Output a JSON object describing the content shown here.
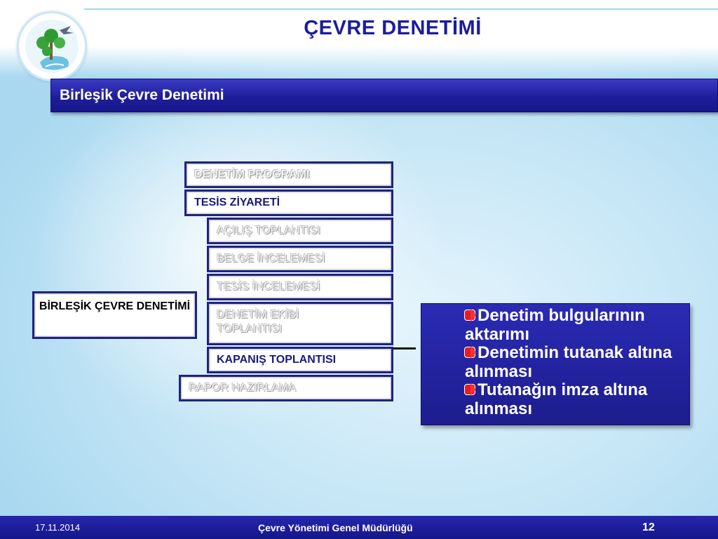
{
  "slide": {
    "title": "ÇEVRE DENETİMİ",
    "section": "Birleşik Çevre Denetimi"
  },
  "diagram": {
    "root": "BİRLEŞİK ÇEVRE DENETİMİ",
    "steps": [
      {
        "label": "DENETİM PROGRAMI",
        "state": "faded"
      },
      {
        "label": "TESİS ZİYARETİ",
        "state": "active"
      },
      {
        "label": "AÇILIŞ TOPLANTISI",
        "state": "faded"
      },
      {
        "label": "BELGE İNCELEMESİ",
        "state": "faded"
      },
      {
        "label": "TESİS İNCELEMESİ",
        "state": "faded"
      },
      {
        "label": "DENETİM EKİBİ TOPLANTISI",
        "state": "faded"
      },
      {
        "label": "KAPANIŞ TOPLANTISI",
        "state": "active"
      },
      {
        "label": "RAPOR HAZIRLAMA",
        "state": "faded"
      }
    ]
  },
  "details": {
    "items": [
      "Denetim bulgularının aktarımı",
      "Denetimin tutanak altına alınması",
      "Tutanağın imza altına alınması"
    ],
    "bullet_icon": "red-arrow-bullet-icon"
  },
  "footer": {
    "date": "17.11.2014",
    "organization": "Çevre Yönetimi Genel Müdürlüğü",
    "page": "12"
  },
  "colors": {
    "title": "#1c1c9e",
    "banner": "#1e1e9c",
    "box_border": "#1f237f",
    "footer": "#16168a"
  }
}
